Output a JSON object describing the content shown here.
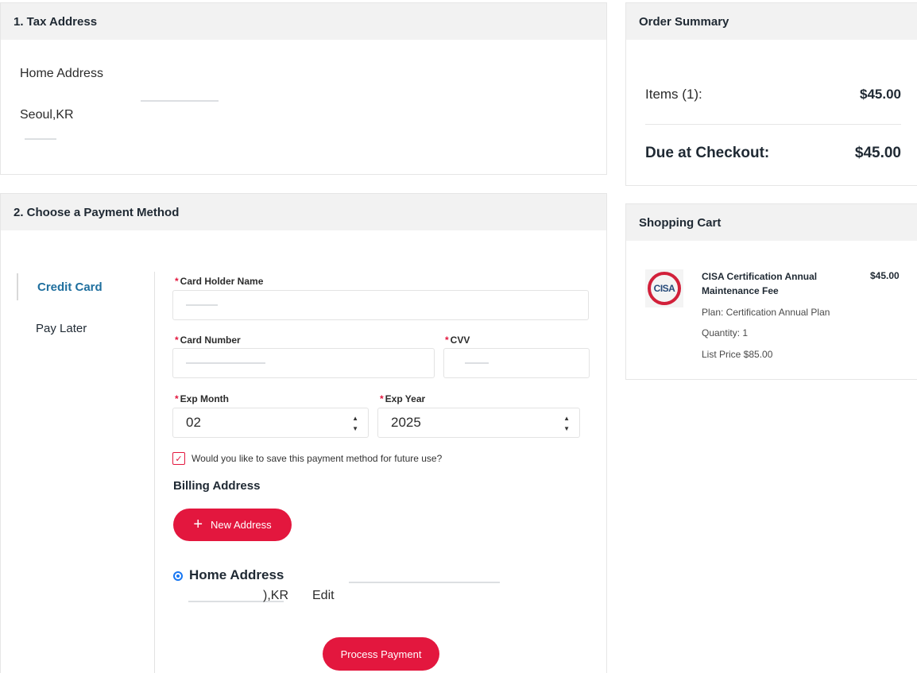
{
  "tax_section": {
    "title": "1. Tax Address",
    "address_name": "Home Address",
    "city_country": "Seoul,KR"
  },
  "payment_section": {
    "title": "2. Choose a Payment Method",
    "methods": [
      {
        "label": "Credit Card",
        "active": true
      },
      {
        "label": "Pay Later",
        "active": false
      }
    ],
    "fields": {
      "card_holder_label": "Card Holder Name",
      "card_number_label": "Card Number",
      "cvv_label": "CVV",
      "exp_month_label": "Exp Month",
      "exp_month_value": "02",
      "exp_year_label": "Exp Year",
      "exp_year_value": "2025",
      "required_mark": "*"
    },
    "save_method_label": "Would you like to save this payment method for future use?",
    "billing_title": "Billing Address",
    "new_address_label": "New Address",
    "home_address_title": "Home Address",
    "home_address_line": "),KR",
    "edit_label": "Edit",
    "process_label": "Process Payment"
  },
  "order_summary": {
    "title": "Order Summary",
    "items_label": "Items (1):",
    "items_value": "$45.00",
    "due_label": "Due at Checkout:",
    "due_value": "$45.00"
  },
  "cart": {
    "title": "Shopping Cart",
    "logo_text": "CISA",
    "item_name": "CISA Certification Annual Maintenance Fee",
    "item_price": "$45.00",
    "plan": "Plan: Certification Annual Plan",
    "quantity": "Quantity: 1",
    "list_price": "List Price  $85.00"
  },
  "colors": {
    "accent": "#e3173e",
    "active_method": "#1f6f9e",
    "radio": "#1877f2"
  }
}
